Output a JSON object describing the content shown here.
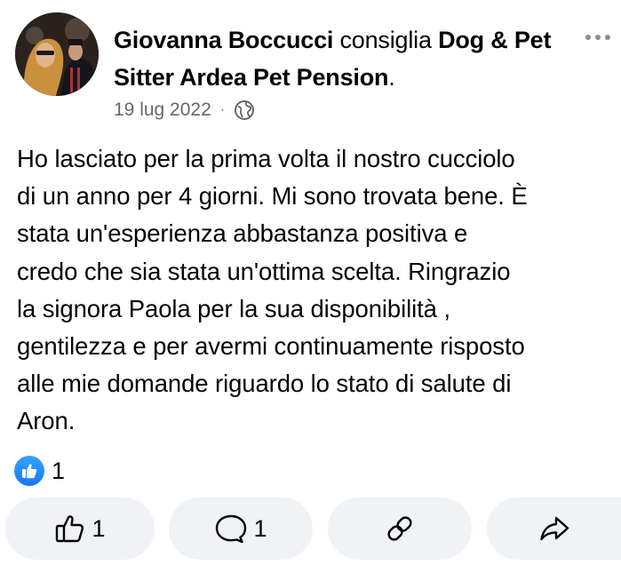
{
  "post": {
    "author": "Giovanna Boccucci",
    "verb": "consiglia",
    "page_name": "Dog & Pet Sitter Ardea Pet Pension",
    "page_name_suffix": ".",
    "date": "19 lug 2022",
    "separator": "·",
    "privacy_icon": "globe-icon",
    "text": "Ho lasciato per la prima volta il nostro cucciolo\ndi un anno per 4 giorni. Mi sono trovata bene. È\nstata un'esperienza abbastanza positiva e\ncredo che sia stata un'ottima scelta. Ringrazio\nla signora Paola per la sua disponibilità ,\ngentilezza e per avermi continuamente risposto\nalle mie domande riguardo lo stato di salute di\nAron."
  },
  "reactions": {
    "icon": "like-icon",
    "count": "1"
  },
  "actions": {
    "like_count": "1",
    "comment_count": "1",
    "link_icon": "link-icon",
    "share_icon": "share-icon"
  },
  "colors": {
    "accent": "#1877f2",
    "secondary_text": "#65676b",
    "button_bg": "#f0f2f5"
  }
}
